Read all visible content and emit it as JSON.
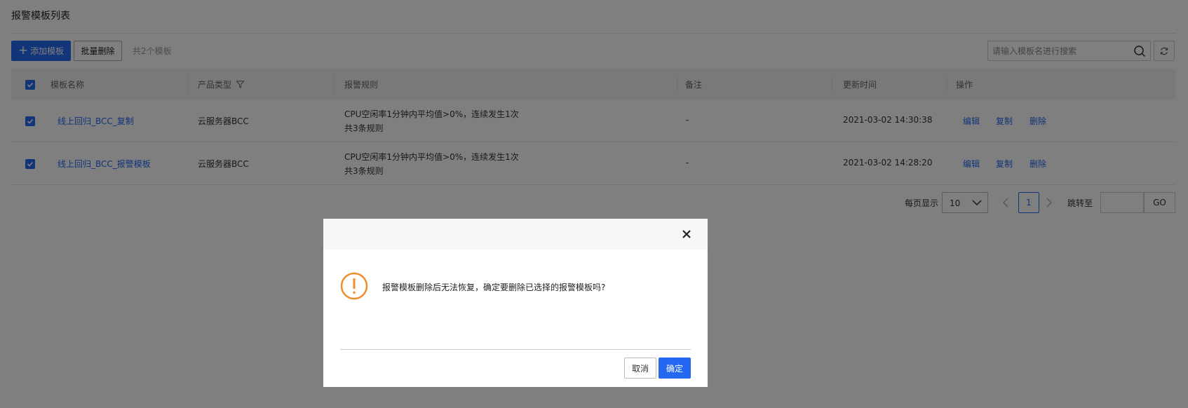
{
  "header": {
    "title": "报警模板列表"
  },
  "toolbar": {
    "add_label": "添加模板",
    "batch_delete_label": "批量删除",
    "count_text": "共2个模板",
    "search_placeholder": "请输入模板名进行搜索"
  },
  "table": {
    "columns": [
      "模板名称",
      "产品类型",
      "报警规则",
      "备注",
      "更新时间",
      "操作"
    ],
    "rows": [
      {
        "name": "线上回归_BCC_复制",
        "product": "云服务器BCC",
        "rule_line1": "CPU空闲率1分钟内平均值>0%，连续发生1次",
        "rule_line2": "共3条规则",
        "note": "-",
        "updated": "2021-03-02 14:30:38",
        "actions": [
          "编辑",
          "复制",
          "删除"
        ]
      },
      {
        "name": "线上回归_BCC_报警模板",
        "product": "云服务器BCC",
        "rule_line1": "CPU空闲率1分钟内平均值>0%，连续发生1次",
        "rule_line2": "共3条规则",
        "note": "-",
        "updated": "2021-03-02 14:28:20",
        "actions": [
          "编辑",
          "复制",
          "删除"
        ]
      }
    ]
  },
  "pagination": {
    "per_page_label": "每页显示",
    "page_size": "10",
    "current_page": "1",
    "jump_label": "跳转至",
    "go_label": "GO"
  },
  "dialog": {
    "message": "报警模板删除后无法恢复，确定要删除已选择的报警模板吗?",
    "cancel_label": "取消",
    "confirm_label": "确定"
  },
  "colors": {
    "primary": "#2468f2",
    "warning": "#f08c2e"
  }
}
